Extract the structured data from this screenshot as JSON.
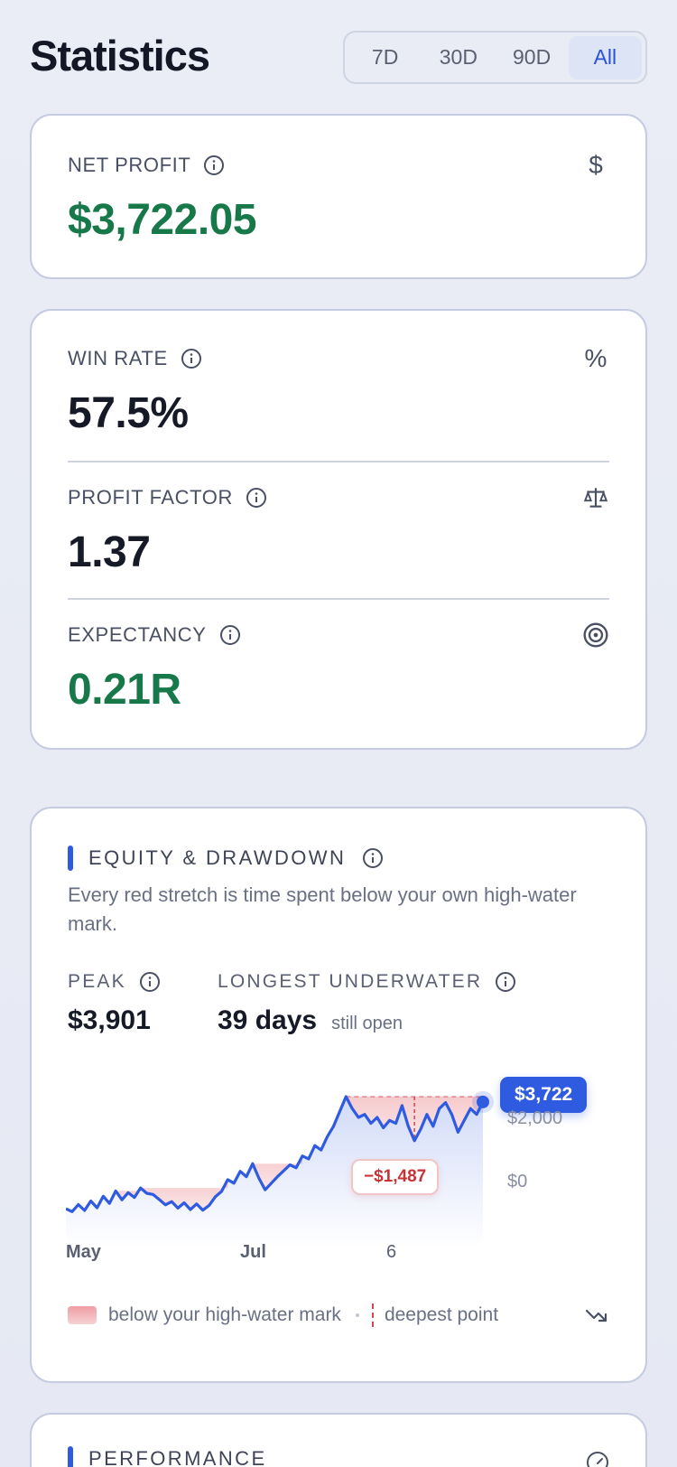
{
  "header": {
    "title": "Statistics",
    "ranges": [
      "7D",
      "30D",
      "90D",
      "All"
    ],
    "active_range": "All"
  },
  "net_profit": {
    "label": "NET PROFIT",
    "value": "$3,722.05",
    "glyph": "$"
  },
  "win_rate": {
    "label": "WIN RATE",
    "value": "57.5%",
    "glyph": "%"
  },
  "profit_factor": {
    "label": "PROFIT FACTOR",
    "value": "1.37",
    "icon": "scale-icon"
  },
  "expectancy": {
    "label": "EXPECTANCY",
    "value": "0.21R",
    "icon": "target-icon"
  },
  "equity": {
    "title": "EQUITY & DRAWDOWN",
    "description": "Every red stretch is time spent below your own high-water mark.",
    "peak_label": "PEAK",
    "peak_value": "$3,901",
    "underwater_label": "LONGEST UNDERWATER",
    "underwater_value": "39 days",
    "underwater_note": "still open",
    "current_pill": "$3,722",
    "drawdown_pill": "−$1,487",
    "legend_below": "below your high-water mark",
    "legend_deepest": "deepest point"
  },
  "performance": {
    "title": "PERFORMANCE"
  },
  "colors": {
    "accent": "#2f5be0",
    "profit": "#17784a",
    "drawdown": "#d2474c"
  },
  "chart_data": {
    "type": "line",
    "title": "",
    "xlabel": "",
    "ylabel": "",
    "x_ticks": [
      "May",
      "Jul",
      "6"
    ],
    "y_ticks": [
      "$0",
      "$2,000"
    ],
    "ylim": [
      0,
      3901
    ],
    "series": [
      {
        "values": [
          120,
          20,
          260,
          60,
          380,
          150,
          540,
          300,
          720,
          420,
          660,
          500,
          820,
          640,
          600,
          430,
          250,
          360,
          140,
          320,
          90,
          280,
          70,
          230,
          520,
          700,
          1100,
          980,
          1380,
          1200,
          1640,
          1150,
          760,
          980,
          1200,
          1400,
          1600,
          1500,
          1900,
          1800,
          2250,
          2100,
          2550,
          2900,
          3400,
          3901,
          3500,
          3200,
          3300,
          3000,
          3200,
          2850,
          3100,
          3000,
          3600,
          2900,
          2414,
          2800,
          3300,
          2900,
          3500,
          3700,
          3300,
          2700,
          3100,
          3500,
          3300,
          3722
        ]
      }
    ],
    "drawdown_min": -1487
  }
}
